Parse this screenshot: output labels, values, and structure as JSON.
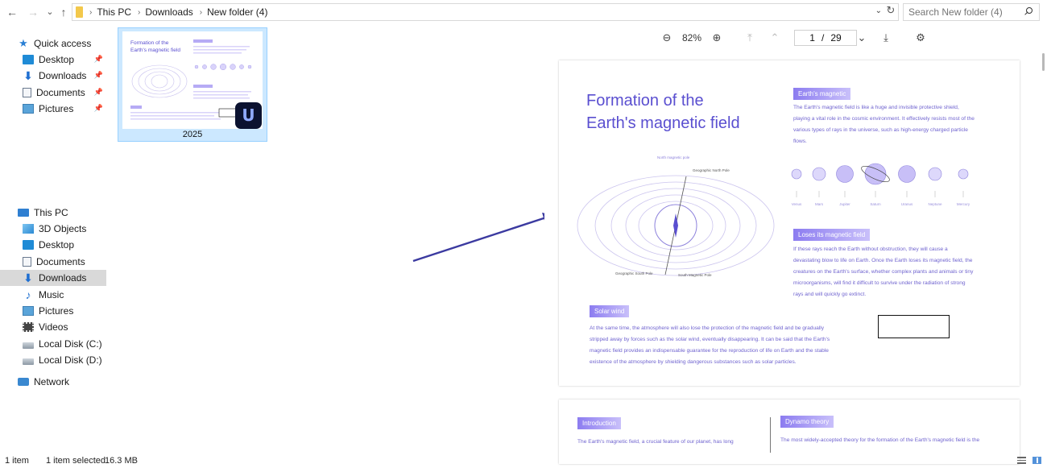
{
  "address_bar": {
    "back": "←",
    "forward": "→",
    "recent": "⌄",
    "up": "↑",
    "breadcrumbs": [
      "This PC",
      "Downloads",
      "New folder (4)"
    ],
    "separator": "›",
    "dropdown": "⌄",
    "refresh": "↻",
    "search_placeholder": "Search New folder (4)"
  },
  "sidebar": {
    "quick_access_label": "Quick access",
    "quick_items": [
      {
        "label": "Desktop",
        "icon": "desktop-icon",
        "pinned": true
      },
      {
        "label": "Downloads",
        "icon": "downloads-icon",
        "pinned": true
      },
      {
        "label": "Documents",
        "icon": "documents-icon",
        "pinned": true
      },
      {
        "label": "Pictures",
        "icon": "pictures-icon",
        "pinned": true
      }
    ],
    "this_pc_label": "This PC",
    "pc_items": [
      {
        "label": "3D Objects",
        "icon": "3d-objects-icon"
      },
      {
        "label": "Desktop",
        "icon": "desktop-icon"
      },
      {
        "label": "Documents",
        "icon": "documents-icon"
      },
      {
        "label": "Downloads",
        "icon": "downloads-icon",
        "selected": true
      },
      {
        "label": "Music",
        "icon": "music-icon"
      },
      {
        "label": "Pictures",
        "icon": "pictures-icon"
      },
      {
        "label": "Videos",
        "icon": "videos-icon"
      },
      {
        "label": "Local Disk (C:)",
        "icon": "local-disk-icon"
      },
      {
        "label": "Local Disk (D:)",
        "icon": "local-disk-icon"
      }
    ],
    "network_label": "Network",
    "pin_glyph": "📌"
  },
  "file": {
    "name": "2025",
    "thumb_title": "Formation of the Earth's magnetic field",
    "app_badge_glyph": "U"
  },
  "preview": {
    "zoom_out": "⊖",
    "zoom_level": "82%",
    "zoom_in": "⊕",
    "first_page": "⤒",
    "prev_page": "⌃",
    "current_page": "1",
    "page_separator": "/",
    "total_pages": "29",
    "next_page": "⌄",
    "last_page": "⤓",
    "settings": "⚙",
    "doc": {
      "title_line1": "Formation of the",
      "title_line2": "Earth's magnetic field",
      "tag_earths_magnetic": "Earth's magnetic",
      "para_earths_magnetic": "The Earth's magnetic field is like a huge and invisible protective shield, playing a vital role in the cosmic environment. It effectively resists most of the various types of rays in the universe, such as high-energy charged particle flows.",
      "planets": [
        "Venus",
        "Mars",
        "Jupiter",
        "Saturn",
        "Uranus",
        "Neptune",
        "Mercury"
      ],
      "tag_loses": "Loses its magnetic field",
      "para_loses": "If these rays reach the Earth without obstruction, they will cause a devastating blow to life on Earth. Once the Earth loses its magnetic field, the creatures on the Earth's surface, whether complex plants and animals or tiny microorganisms, will find it difficult to survive under the radiation of strong rays and will quickly go extinct.",
      "tag_solar": "Solar wind",
      "para_solar": "At the same time, the atmosphere will also lose the protection of the magnetic field and be gradually stripped away by forces such as the solar wind, eventually disappearing. It can be said that the Earth's magnetic field provides an indispensable guarantee for the reproduction of life on Earth and the stable existence of the atmosphere by shielding dangerous substances such as solar particles.",
      "label_north_magnetic": "North magnetic pole",
      "label_geo_north": "Geographic North Pole",
      "label_geo_south": "Geographic South Pole",
      "label_south_magnetic": "South Magnetic Pole",
      "tag_intro": "Introduction",
      "para_intro": "The Earth's magnetic field, a crucial feature of our planet, has long",
      "tag_dynamo": "Dynamo theory",
      "para_dynamo": "The most widely-accepted theory for the formation of the Earth's magnetic field is the"
    }
  },
  "status": {
    "item_count": "1 item",
    "selection": "1 item selected",
    "size": "16.3 MB"
  },
  "colors": {
    "accent_purple": "#5a4fd0",
    "selection_blue": "#cce8ff",
    "arrow": "#3b3aa0"
  }
}
